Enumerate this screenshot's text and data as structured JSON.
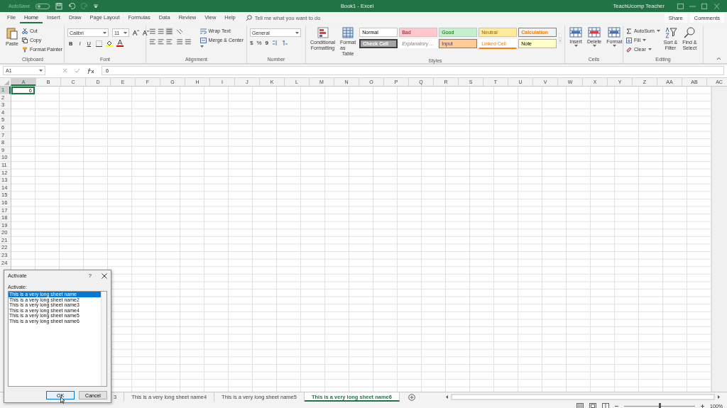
{
  "title_bar": {
    "autosave": "AutoSave",
    "autosave_on": false,
    "document_title": "Book1  -  Excel",
    "user": "TeachUcomp Teacher"
  },
  "menu_tabs": [
    {
      "label": "File",
      "selected": false
    },
    {
      "label": "Home",
      "selected": true
    },
    {
      "label": "Insert",
      "selected": false
    },
    {
      "label": "Draw",
      "selected": false
    },
    {
      "label": "Page Layout",
      "selected": false
    },
    {
      "label": "Formulas",
      "selected": false
    },
    {
      "label": "Data",
      "selected": false
    },
    {
      "label": "Review",
      "selected": false
    },
    {
      "label": "View",
      "selected": false
    },
    {
      "label": "Help",
      "selected": false
    }
  ],
  "tell_me": {
    "placeholder": "Tell me what you want to do"
  },
  "share": "Share",
  "comments": "Comments",
  "ribbon": {
    "clipboard": {
      "paste": "Paste",
      "cut": "Cut",
      "copy": "Copy",
      "format_painter": "Format Painter",
      "label": "Clipboard"
    },
    "font": {
      "font_name": "Calibri",
      "font_size": "11",
      "bold": "B",
      "italic": "I",
      "underline": "U",
      "label": "Font"
    },
    "alignment": {
      "wrap_text": "Wrap Text",
      "merge_center": "Merge & Center",
      "label": "Alignment"
    },
    "number": {
      "format": "General",
      "currency": "$",
      "percent": "%",
      "comma": "9",
      "label": "Number"
    },
    "styles": {
      "conditional_formatting": [
        "Conditional",
        "Formatting"
      ],
      "format_as_table": [
        "Format as",
        "Table"
      ],
      "cell_styles": [
        {
          "label": "Normal",
          "kind": "normal"
        },
        {
          "label": "Bad",
          "kind": "bad"
        },
        {
          "label": "Good",
          "kind": "good"
        },
        {
          "label": "Neutral",
          "kind": "neutral"
        },
        {
          "label": "Calculation",
          "kind": "calculation"
        },
        {
          "label": "Check Cell",
          "kind": "check"
        },
        {
          "label": "Explanatory ...",
          "kind": "explanatory"
        },
        {
          "label": "Input",
          "kind": "input"
        },
        {
          "label": "Linked Cell",
          "kind": "linked"
        },
        {
          "label": "Note",
          "kind": "note"
        }
      ],
      "label": "Styles"
    },
    "cells": {
      "buttons": [
        "Insert",
        "Delete",
        "Format"
      ],
      "label": "Cells"
    },
    "editing": {
      "autosum": "AutoSum",
      "fill": "Fill",
      "clear": "Clear",
      "sort_filter": [
        "Sort &",
        "Filter"
      ],
      "find_select": [
        "Find &",
        "Select"
      ],
      "label": "Editing"
    }
  },
  "formula_bar": {
    "name_box": "A1",
    "value": "6"
  },
  "sheet": {
    "columns": [
      "A",
      "B",
      "C",
      "D",
      "E",
      "F",
      "G",
      "H",
      "I",
      "J",
      "K",
      "L",
      "M",
      "N",
      "O",
      "P",
      "Q",
      "R",
      "S",
      "T",
      "U",
      "V",
      "W",
      "X",
      "Y",
      "Z",
      "AA",
      "AB",
      "AC"
    ],
    "rows": [
      "1",
      "2",
      "3",
      "4",
      "5",
      "6",
      "7",
      "8",
      "9",
      "10",
      "11",
      "12",
      "13",
      "14",
      "15",
      "16",
      "17",
      "18",
      "19",
      "20",
      "21",
      "22",
      "23",
      "24"
    ],
    "a1_value": "6"
  },
  "sheet_tabs": [
    {
      "label": "3",
      "selected": false
    },
    {
      "label": "This is a very long sheet name4",
      "selected": false
    },
    {
      "label": "This is a very long sheet name5",
      "selected": false
    },
    {
      "label": "This is a very long sheet name6",
      "selected": true
    }
  ],
  "status_bar": {
    "zoom": {
      "level": 0.5,
      "reading": "100%"
    }
  },
  "dialog": {
    "title": "Activate",
    "help": "?",
    "list_label": "Activate:",
    "items": [
      {
        "label": "This is a very long sheet name",
        "selected": true
      },
      {
        "label": "This is a very long sheet name2",
        "selected": false
      },
      {
        "label": "This is a very long sheet name3",
        "selected": false
      },
      {
        "label": "This is a very long sheet name4",
        "selected": false
      },
      {
        "label": "This is a very long sheet name5",
        "selected": false
      },
      {
        "label": "This is a very long sheet name6",
        "selected": false
      }
    ],
    "ok": "OK",
    "cancel": "Cancel"
  }
}
